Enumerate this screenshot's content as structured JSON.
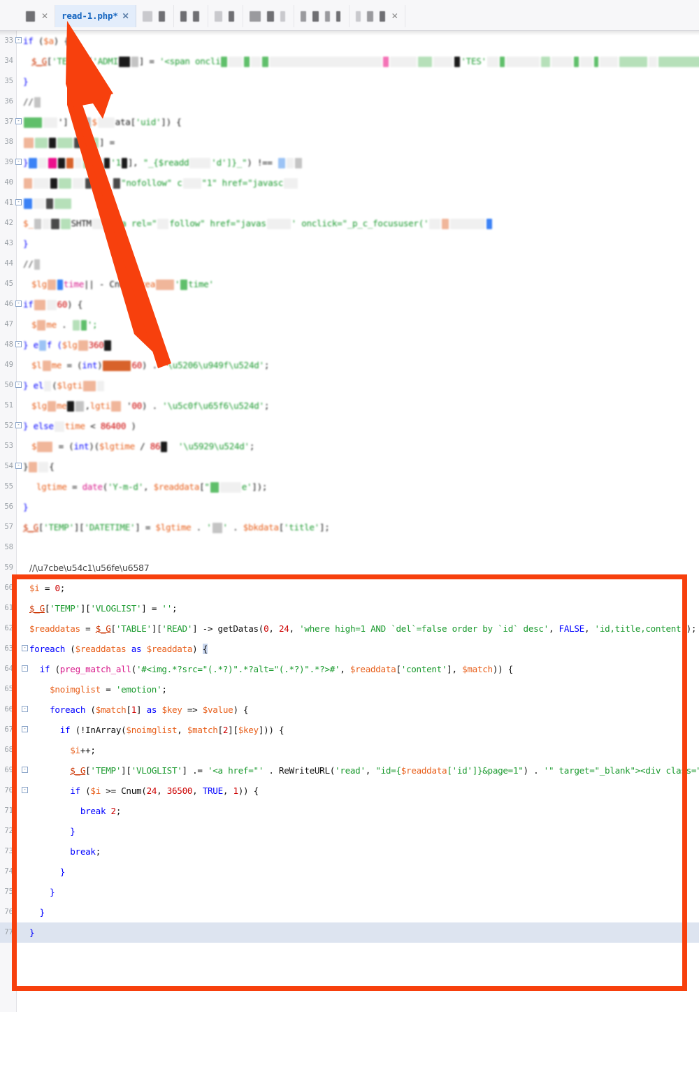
{
  "window": {
    "title": "read-1.php*",
    "accent_red": "#f7400d",
    "active_tab_bg": "#e3edfb",
    "active_tab_fg": "#1565c0",
    "current_line_bg": "#dde4f0"
  },
  "tabbar": {
    "tabs": [
      {
        "label": "",
        "redacted": true,
        "active": false,
        "close": "✕"
      },
      {
        "label": "read-1.php*",
        "redacted": false,
        "active": true,
        "close": "✕"
      },
      {
        "label": "",
        "redacted": true,
        "active": false,
        "close": ""
      },
      {
        "label": "",
        "redacted": true,
        "active": false,
        "close": ""
      },
      {
        "label": "",
        "redacted": true,
        "active": false,
        "close": ""
      },
      {
        "label": "",
        "redacted": true,
        "active": false,
        "close": ""
      },
      {
        "label": "",
        "redacted": true,
        "active": false,
        "close": ""
      },
      {
        "label": "",
        "redacted": true,
        "active": false,
        "close": ""
      },
      {
        "label": "",
        "redacted": true,
        "active": false,
        "close": "✕"
      }
    ]
  },
  "annotation": {
    "arrow_color": "#f7400d",
    "arrow_label": "points to active tab read-1.php*",
    "box_color": "#f7400d",
    "box_label": "highlighted code block lines 58-77"
  },
  "editor": {
    "first_line_number": 33,
    "current_line_number": 77,
    "lines": [
      {
        "n": 33,
        "fold": "-",
        "text": "if ($a) {",
        "redacted": true
      },
      {
        "n": 34,
        "fold": "",
        "text": "$_G['TEMP']['ADMIN...'] = '<span onclif...",
        "redacted": true
      },
      {
        "n": 35,
        "fold": "",
        "text": "}",
        "redacted": true
      },
      {
        "n": 36,
        "fold": "",
        "text": "//?",
        "redacted": true
      },
      {
        "n": 37,
        "fold": "-",
        "text": "... = $...data['uid']) {",
        "redacted": true
      },
      {
        "n": 38,
        "fold": "",
        "text": "... =",
        "redacted": true
      },
      {
        "n": 39,
        "fold": "-",
        "text": "...'1...', \"_{$readd...'d']}_\") !== ...",
        "redacted": true
      },
      {
        "n": 40,
        "fold": "",
        "text": "... '<a rel=\"nofollow\" cl... =\"1\" href=\"javasc...",
        "redacted": true
      },
      {
        "n": 41,
        "fold": "-",
        "text": "",
        "redacted": true
      },
      {
        "n": 42,
        "fold": "",
        "text": "...SHTML... '<a rel=\"nofollow\" href=\"javas... ' onclick=\"_p_c_focususer('",
        "redacted": true
      },
      {
        "n": 43,
        "fold": "",
        "text": "}",
        "redacted": true
      },
      {
        "n": 44,
        "fold": "",
        "text": "//?",
        "redacted": true
      },
      {
        "n": 45,
        "fold": "",
        "text": "$lgtime || - Cnum($rea...' ...time'",
        "redacted": true
      },
      {
        "n": 46,
        "fold": "-",
        "text": "if ( ...  60) {",
        "redacted": true
      },
      {
        "n": 47,
        "fold": "",
        "text": "$...me . '...';",
        "redacted": true
      },
      {
        "n": 48,
        "fold": "-",
        "text": "} elseif ($lg... 3600",
        "redacted": true
      },
      {
        "n": 49,
        "fold": "",
        "text": "$lgtime = (int)( ... 60) . '分钟前';",
        "redacted": true
      },
      {
        "n": 50,
        "fold": "-",
        "text": "} else if ($lgti...",
        "redacted": true
      },
      {
        "n": 51,
        "fold": "",
        "text": "$lgtime ... lgtime ... '00' . '小时前';",
        "redacted": true
      },
      {
        "n": 52,
        "fold": "-",
        "text": "} else if ($lgtime < 86400 )",
        "redacted": true
      },
      {
        "n": 53,
        "fold": "",
        "text": "$... = (int)($lgtime / 86... '天前';",
        "redacted": true
      },
      {
        "n": 54,
        "fold": "-",
        "text": "} ... {",
        "redacted": true
      },
      {
        "n": 55,
        "fold": "",
        "text": "$lgtime = date('Y-m-d', $readdata['...e']);",
        "redacted": true
      },
      {
        "n": 56,
        "fold": "",
        "text": "}",
        "redacted": true
      },
      {
        "n": 57,
        "fold": "",
        "text": "$_G['TEMP']['DATETIME'] = $lgtime . '✐' . $bkdata['title'];",
        "redacted": true
      },
      {
        "n": 58,
        "fold": "",
        "text": "",
        "redacted": false
      },
      {
        "n": 59,
        "fold": "",
        "text": "//精品图文",
        "redacted": false
      },
      {
        "n": 60,
        "fold": "",
        "text": "$i = 0;",
        "redacted": false
      },
      {
        "n": 61,
        "fold": "",
        "text": "$_G['TEMP']['VLOGLIST'] = '';",
        "redacted": false
      },
      {
        "n": 62,
        "fold": "",
        "text": "$readdatas = $_G['TABLE']['READ'] -> getDatas(0, 24, 'where high=1 AND `del`=false order by `id` desc', FALSE, 'id,title,content');",
        "redacted": false
      },
      {
        "n": 63,
        "fold": "-",
        "text": "foreach ($readdatas as $readdata) {",
        "redacted": false
      },
      {
        "n": 64,
        "fold": "-",
        "text": "  if (preg_match_all('#<img.*?src=\"(.*?)\".*?alt=\"(.*?)\".*?>#', $readdata['content'], $match)) {",
        "redacted": false
      },
      {
        "n": 65,
        "fold": "",
        "text": "    $noimglist = 'emotion';",
        "redacted": false
      },
      {
        "n": 66,
        "fold": "-",
        "text": "    foreach ($match[1] as $key => $value) {",
        "redacted": false
      },
      {
        "n": 67,
        "fold": "-",
        "text": "      if (!InArray($noimglist, $match[2][$key])) {",
        "redacted": false
      },
      {
        "n": 68,
        "fold": "",
        "text": "        $i++;",
        "redacted": false
      },
      {
        "n": 69,
        "fold": "-",
        "text": "        $_G['TEMP']['VLOGLIST'] .= '<a href=\"' . ReWriteURL('read', \"id={$readdata['id']}&page=1\") . '\" target=\"_blank\"><div class=\"vloglist_div\"><img src=\"' . $value . '\" class=\"vloglist_img\" />' . $readdata['title'] . '</div></a>';",
        "redacted": false
      },
      {
        "n": 70,
        "fold": "-",
        "text": "        if ($i >= Cnum(24, 36500, TRUE, 1)) {",
        "redacted": false
      },
      {
        "n": 71,
        "fold": "",
        "text": "          break 2;",
        "redacted": false
      },
      {
        "n": 72,
        "fold": "",
        "text": "        }",
        "redacted": false
      },
      {
        "n": 73,
        "fold": "",
        "text": "        break;",
        "redacted": false
      },
      {
        "n": 74,
        "fold": "",
        "text": "      }",
        "redacted": false
      },
      {
        "n": 75,
        "fold": "",
        "text": "    }",
        "redacted": false
      },
      {
        "n": 76,
        "fold": "",
        "text": "  }",
        "redacted": false
      },
      {
        "n": 77,
        "fold": "",
        "text": "}",
        "redacted": false,
        "current": true
      }
    ]
  }
}
